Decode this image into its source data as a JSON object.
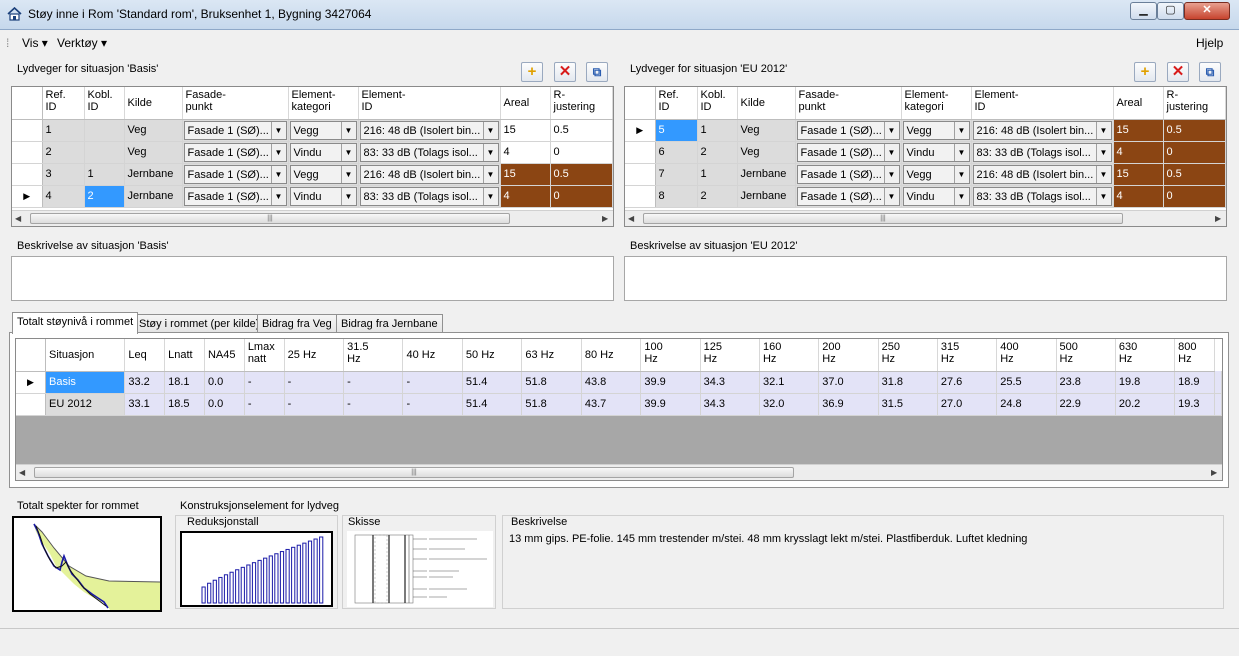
{
  "window": {
    "title": "Støy inne i Rom 'Standard rom', Bruksenhet 1, Bygning 3427064",
    "minimize": "▁",
    "maximize": "▢",
    "close": "✕"
  },
  "menu": {
    "vis": "Vis ▾",
    "verktoy": "Verktøy ▾",
    "hjelp": "Hjelp"
  },
  "toolbar": {
    "add": "+",
    "delete": "✕",
    "copy": "⧉"
  },
  "basis": {
    "label": "Lydveger for situasjon 'Basis'",
    "description_label": "Beskrivelse av situasjon 'Basis'",
    "rows": [
      {
        "ref": "1",
        "kobl": "",
        "kilde": "Veg",
        "fasade": "Fasade 1 (SØ)...",
        "kategori": "Vegg",
        "element": "216: 48 dB (Isolert bin...",
        "areal": "15",
        "rjust": "0.5"
      },
      {
        "ref": "2",
        "kobl": "",
        "kilde": "Veg",
        "fasade": "Fasade 1 (SØ)...",
        "kategori": "Vindu",
        "element": "83: 33 dB (Tolags isol...",
        "areal": "4",
        "rjust": "0"
      },
      {
        "ref": "3",
        "kobl": "1",
        "kilde": "Jernbane",
        "fasade": "Fasade 1 (SØ)...",
        "kategori": "Vegg",
        "element": "216: 48 dB (Isolert bin...",
        "areal": "15",
        "rjust": "0.5"
      },
      {
        "ref": "4",
        "kobl": "2",
        "kilde": "Jernbane",
        "fasade": "Fasade 1 (SØ)...",
        "kategori": "Vindu",
        "element": "83: 33 dB (Tolags isol...",
        "areal": "4",
        "rjust": "0"
      }
    ]
  },
  "eu": {
    "label": "Lydveger for situasjon 'EU 2012'",
    "description_label": "Beskrivelse av situasjon 'EU 2012'",
    "rows": [
      {
        "ref": "5",
        "kobl": "1",
        "kilde": "Veg",
        "fasade": "Fasade 1 (SØ)...",
        "kategori": "Vegg",
        "element": "216: 48 dB (Isolert bin...",
        "areal": "15",
        "rjust": "0.5"
      },
      {
        "ref": "6",
        "kobl": "2",
        "kilde": "Veg",
        "fasade": "Fasade 1 (SØ)...",
        "kategori": "Vindu",
        "element": "83: 33 dB (Tolags isol...",
        "areal": "4",
        "rjust": "0"
      },
      {
        "ref": "7",
        "kobl": "1",
        "kilde": "Jernbane",
        "fasade": "Fasade 1 (SØ)...",
        "kategori": "Vegg",
        "element": "216: 48 dB (Isolert bin...",
        "areal": "15",
        "rjust": "0.5"
      },
      {
        "ref": "8",
        "kobl": "2",
        "kilde": "Jernbane",
        "fasade": "Fasade 1 (SØ)...",
        "kategori": "Vindu",
        "element": "83: 33 dB (Tolags isol...",
        "areal": "4",
        "rjust": "0"
      }
    ]
  },
  "path_headers": {
    "ref": [
      "Ref.",
      "ID"
    ],
    "kobl": [
      "Kobl.",
      "ID"
    ],
    "kilde": "Kilde",
    "fasade": [
      "Fasade-",
      "punkt"
    ],
    "kategori": [
      "Element-",
      "kategori"
    ],
    "element": [
      "Element-",
      "ID"
    ],
    "areal": "Areal",
    "rjust": [
      "R-",
      "justering"
    ]
  },
  "tabs": [
    "Totalt støynivå i rommet",
    "Støy i rommet (per kilde)",
    "Bidrag fra Veg",
    "Bidrag fra Jernbane"
  ],
  "levels": {
    "headers": [
      [
        "Situasjon"
      ],
      [
        "Leq"
      ],
      [
        "Lnatt"
      ],
      [
        "NA45"
      ],
      [
        "Lmax",
        "natt"
      ],
      [
        "25 Hz"
      ],
      [
        "31.5",
        "Hz"
      ],
      [
        "40 Hz"
      ],
      [
        "50 Hz"
      ],
      [
        "63 Hz"
      ],
      [
        "80 Hz"
      ],
      [
        "100",
        "Hz"
      ],
      [
        "125",
        "Hz"
      ],
      [
        "160",
        "Hz"
      ],
      [
        "200",
        "Hz"
      ],
      [
        "250",
        "Hz"
      ],
      [
        "315",
        "Hz"
      ],
      [
        "400",
        "Hz"
      ],
      [
        "500",
        "Hz"
      ],
      [
        "630",
        "Hz"
      ],
      [
        "800",
        "Hz"
      ]
    ],
    "rows": [
      [
        "Basis",
        "33.2",
        "18.1",
        "0.0",
        "-",
        "-",
        "-",
        "-",
        "51.4",
        "51.8",
        "43.8",
        "39.9",
        "34.3",
        "32.1",
        "37.0",
        "31.8",
        "27.6",
        "25.5",
        "23.8",
        "19.8",
        "18.9"
      ],
      [
        "EU 2012",
        "33.1",
        "18.5",
        "0.0",
        "-",
        "-",
        "-",
        "-",
        "51.4",
        "51.8",
        "43.7",
        "39.9",
        "34.3",
        "32.0",
        "36.9",
        "31.5",
        "27.0",
        "24.8",
        "22.9",
        "20.2",
        "19.3"
      ]
    ]
  },
  "bottom": {
    "spectrum_label": "Totalt spekter for rommet",
    "construction_label": "Konstruksjonselement for lydveg",
    "reduction_label": "Reduksjonstall",
    "sketch_label": "Skisse",
    "description_label": "Beskrivelse",
    "description_text": "13 mm gips. PE-folie. 145 mm trestender m/stei. 48 mm krysslagt lekt m/stei. Plastfiberduk. Luftet kledning"
  },
  "colors": {
    "brown": "#8b4513",
    "selection": "#3399ff",
    "lavender": "#e3e3f7",
    "gray": "#dcdcdc",
    "spectrum_fill": "#e4f29a",
    "bars": "#1a1aa8"
  }
}
